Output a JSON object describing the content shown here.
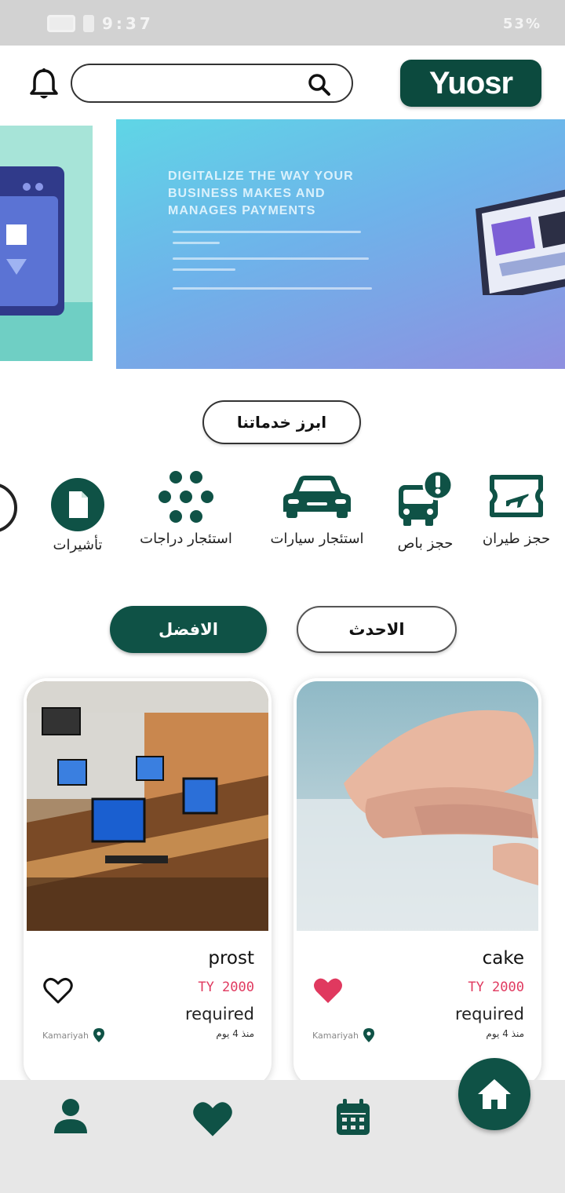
{
  "status_bar": {
    "left_text": "9:37",
    "right_text": "53%"
  },
  "header": {
    "logo_text": "Yuosr",
    "search_placeholder": ""
  },
  "banner": {
    "title": "DIGITALIZE THE WAY YOUR BUSINESS MAKES AND MANAGES PAYMENTS"
  },
  "services": {
    "title": "ابرز خدماتنا",
    "items": [
      {
        "label": "حجز طيران",
        "icon": "plane-ticket-icon"
      },
      {
        "label": "حجز باص",
        "icon": "bus-alert-icon"
      },
      {
        "label": "استئجار سيارات",
        "icon": "car-icon"
      },
      {
        "label": "استئجار دراجات",
        "icon": "bike-dots-icon"
      },
      {
        "label": "تأشيرات",
        "icon": "document-icon"
      }
    ]
  },
  "tabs": {
    "newest": "الاحدث",
    "best": "الافضل"
  },
  "cards": [
    {
      "title": "cake",
      "price": "TY 2000",
      "status": "required",
      "time": "منذ 4 يوم",
      "location": "Kamariyah",
      "favorited": true
    },
    {
      "title": "prost",
      "price": "TY 2000",
      "status": "required",
      "time": "منذ 4 يوم",
      "location": "Kamariyah",
      "favorited": false
    }
  ],
  "colors": {
    "primary": "#0f5246",
    "favorite": "#e0395f"
  },
  "nav": {
    "items": [
      "profile-icon",
      "heart-icon",
      "calendar-icon",
      "home-icon"
    ]
  }
}
